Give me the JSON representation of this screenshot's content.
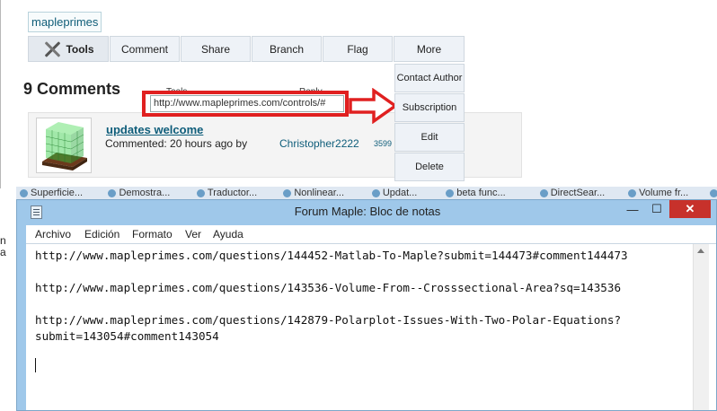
{
  "site": {
    "brand": "mapleprimes",
    "toolbar": [
      "Tools",
      "Comment",
      "Share",
      "Branch",
      "Flag",
      "More"
    ],
    "more_menu": [
      "Contact Author",
      "Subscription",
      "Edit",
      "Delete"
    ],
    "comments_heading": "9 Comments",
    "behind_tooltip": {
      "tools": "Tools",
      "reply": "Reply"
    },
    "hover_url": "http://www.mapleprimes.com/controls/#",
    "comment": {
      "title": "updates welcome",
      "meta": "Commented: 20 hours ago by",
      "author": "Christopher2222",
      "score": "3599"
    },
    "annotation_color": "#e02020",
    "link_color": "#0e5d7a"
  },
  "taskbar": {
    "tabs": [
      "Superficie...",
      "Demostra...",
      "Traductor...",
      "Nonlinear...",
      "Updat...",
      "beta func...",
      "DirectSear...",
      "Volume fr...",
      "Go"
    ]
  },
  "page_edge_letters": [
    "n",
    "a"
  ],
  "notepad": {
    "title": "Forum Maple: Bloc de notas",
    "window_controls": {
      "minimize": "—",
      "maximize": "☐",
      "close": "✕"
    },
    "menu": [
      "Archivo",
      "Edición",
      "Formato",
      "Ver",
      "Ayuda"
    ],
    "lines": [
      "http://www.mapleprimes.com/questions/144452-Matlab-To-Maple?submit=144473#comment144473",
      "",
      "http://www.mapleprimes.com/questions/143536-Volume-From--Crosssectional-Area?sq=143536",
      "",
      "http://www.mapleprimes.com/questions/142879-Polarplot-Issues-With-Two-Polar-Equations?",
      "submit=143054#comment143054"
    ]
  }
}
